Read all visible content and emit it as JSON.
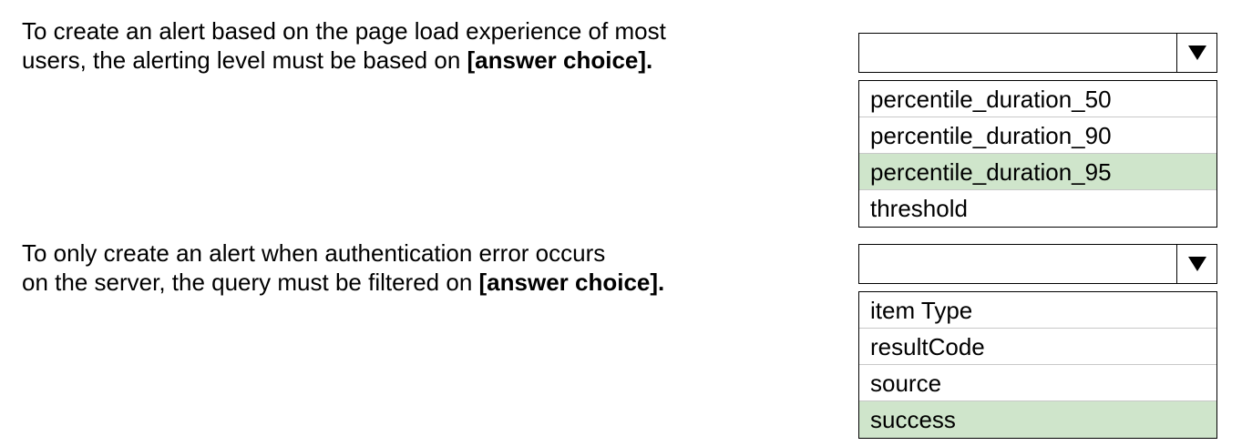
{
  "questions": [
    {
      "line1": "To create an alert based on the page load experience of most",
      "line2_prefix": "users, the alerting level must be based on ",
      "line2_emph": "[answer choice]."
    },
    {
      "line1": "To only create an alert when authentication error occurs",
      "line2_prefix": "on the server, the query must be filtered on ",
      "line2_emph": "[answer choice]."
    }
  ],
  "dropdowns": [
    {
      "selected_value": "",
      "options": [
        "percentile_duration_50",
        "percentile_duration_90",
        "percentile_duration_95",
        "threshold"
      ],
      "highlighted_option": "percentile_duration_95"
    },
    {
      "selected_value": "",
      "options": [
        "item Type",
        "resultCode",
        "source",
        "success"
      ],
      "highlighted_option": "success"
    }
  ],
  "colors": {
    "highlight": "#cfe5cb"
  }
}
